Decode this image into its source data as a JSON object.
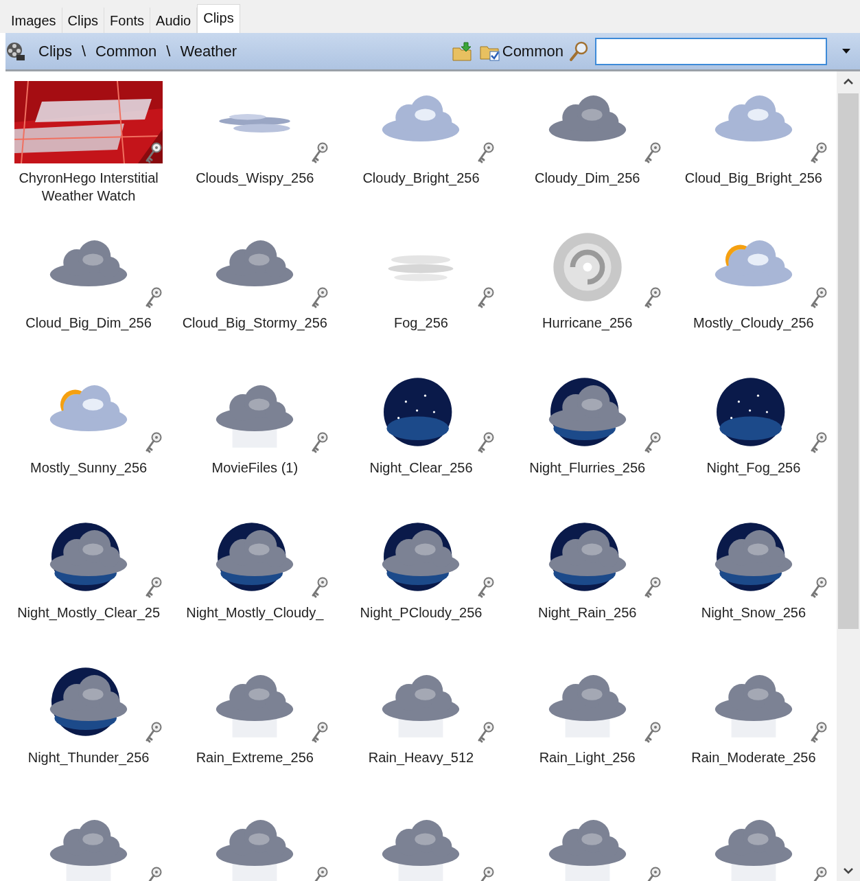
{
  "tabs": [
    {
      "label": "Images",
      "selected": false
    },
    {
      "label": "Clips",
      "selected": false
    },
    {
      "label": "Fonts",
      "selected": false
    },
    {
      "label": "Audio",
      "selected": false
    },
    {
      "label": "Clips",
      "selected": true
    }
  ],
  "toolbar": {
    "breadcrumb": [
      "Clips",
      "\\",
      "Common",
      "\\",
      "Weather"
    ],
    "library_button": "Common"
  },
  "clips": [
    {
      "label": "ChyronHego Interstitial Weather Watch"
    },
    {
      "kind": "wispy",
      "label": "Clouds_Wispy_256"
    },
    {
      "kind": "cloud-bright",
      "label": "Cloudy_Bright_256"
    },
    {
      "kind": "cloud-dim",
      "label": "Cloudy_Dim_256"
    },
    {
      "kind": "cloud-bright",
      "label": "Cloud_Big_Bright_256"
    },
    {
      "kind": "cloud-dim",
      "label": "Cloud_Big_Dim_256"
    },
    {
      "kind": "cloud-dim",
      "label": "Cloud_Big_Stormy_256"
    },
    {
      "kind": "fog",
      "label": "Fog_256"
    },
    {
      "kind": "hurricane",
      "label": "Hurricane_256"
    },
    {
      "kind": "sun-cloud",
      "label": "Mostly_Cloudy_256"
    },
    {
      "kind": "sun-cloud",
      "label": "Mostly_Sunny_256"
    },
    {
      "kind": "rain-cloud",
      "label": "MovieFiles (1)"
    },
    {
      "kind": "night-clear",
      "label": "Night_Clear_256"
    },
    {
      "kind": "night-cloud",
      "label": "Night_Flurries_256"
    },
    {
      "kind": "night-clear",
      "label": "Night_Fog_256"
    },
    {
      "kind": "night-cloud",
      "label": "Night_Mostly_Clear_25"
    },
    {
      "kind": "night-cloud",
      "label": "Night_Mostly_Cloudy_"
    },
    {
      "kind": "night-cloud",
      "label": "Night_PCloudy_256"
    },
    {
      "kind": "night-cloud",
      "label": "Night_Rain_256"
    },
    {
      "kind": "night-cloud",
      "label": "Night_Snow_256"
    },
    {
      "kind": "night-cloud",
      "label": "Night_Thunder_256"
    },
    {
      "kind": "rain-cloud",
      "label": "Rain_Extreme_256"
    },
    {
      "kind": "rain-cloud",
      "label": "Rain_Heavy_512"
    },
    {
      "kind": "rain-cloud",
      "label": "Rain_Light_256"
    },
    {
      "kind": "rain-cloud",
      "label": "Rain_Moderate_256"
    },
    {
      "kind": "rain-cloud"
    },
    {
      "kind": "rain-cloud"
    },
    {
      "kind": "rain-cloud"
    },
    {
      "kind": "rain-cloud"
    },
    {
      "kind": "rain-cloud"
    }
  ]
}
